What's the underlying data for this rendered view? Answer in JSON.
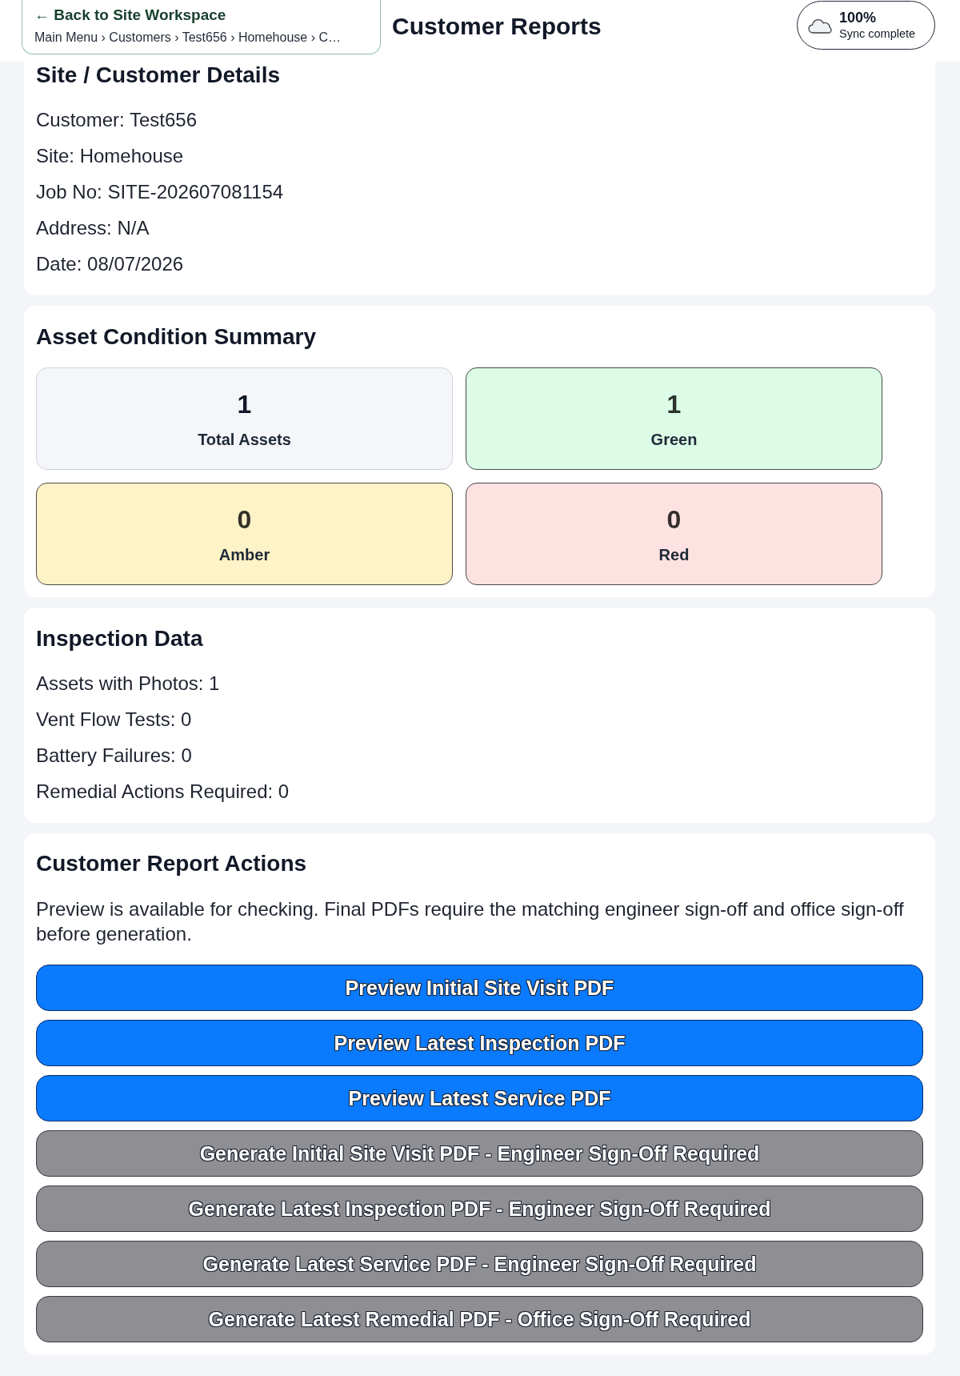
{
  "header": {
    "back_label": "← Back to Site Workspace",
    "breadcrumb": "Main Menu › Customers › Test656 › Homehouse › C…",
    "title": "Customer Reports",
    "sync": {
      "percent": "100%",
      "status": "Sync complete"
    }
  },
  "site_details": {
    "title": "Site / Customer Details",
    "lines": [
      "Customer: Test656",
      "Site: Homehouse",
      "Job No: SITE-202607081154",
      "Address: N/A",
      "Date: 08/07/2026"
    ]
  },
  "asset_summary": {
    "title": "Asset Condition Summary",
    "stats": [
      {
        "kind": "total",
        "value": "1",
        "label": "Total Assets",
        "color": "#f4f6fa"
      },
      {
        "kind": "rating",
        "value": "1",
        "label": "Green",
        "color": "#dcfce7"
      },
      {
        "kind": "rating",
        "value": "0",
        "label": "Amber",
        "color": "#fef3c7"
      },
      {
        "kind": "rating",
        "value": "0",
        "label": "Red",
        "color": "#fee2e2"
      }
    ]
  },
  "inspection_data": {
    "title": "Inspection Data",
    "lines": [
      "Assets with Photos: 1",
      "Vent Flow Tests: 0",
      "Battery Failures: 0",
      "Remedial Actions Required: 0"
    ]
  },
  "report_actions": {
    "title": "Customer Report Actions",
    "note": "Preview is available for checking. Final PDFs require the matching engineer sign-off and office sign-off before generation.",
    "buttons": [
      {
        "label": "Preview Initial Site Visit PDF",
        "disabled": false
      },
      {
        "label": "Preview Latest Inspection PDF",
        "disabled": false
      },
      {
        "label": "Preview Latest Service PDF",
        "disabled": false
      },
      {
        "label": "Generate Initial Site Visit PDF - Engineer Sign-Off Required",
        "disabled": true
      },
      {
        "label": "Generate Latest Inspection PDF - Engineer Sign-Off Required",
        "disabled": true
      },
      {
        "label": "Generate Latest Service PDF - Engineer Sign-Off Required",
        "disabled": true
      },
      {
        "label": "Generate Latest Remedial PDF - Office Sign-Off Required",
        "disabled": true
      }
    ]
  }
}
